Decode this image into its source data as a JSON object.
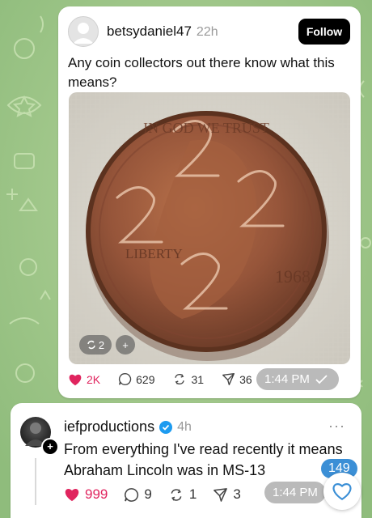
{
  "post1": {
    "username": "betsydaniel47",
    "time": "22h",
    "follow_label": "Follow",
    "text": "Any coin collectors out there know what this means?",
    "image": {
      "coin_top_text": "IN GOD WE TRUST",
      "coin_left_text": "LIBERTY",
      "coin_year": "1968",
      "badge_count": "2",
      "badge_add": "+"
    },
    "likes": "2K",
    "replies": "629",
    "reposts": "31",
    "shares": "36",
    "message_time": "1:44 PM",
    "message_status": "read-checkmark-icon"
  },
  "post2": {
    "username": "iefproductions",
    "time": "4h",
    "more": "···",
    "text": "From everything I've read recently it means Abraham Lincoln was in MS-13",
    "likes": "999",
    "replies": "9",
    "reposts": "1",
    "shares": "3",
    "message_time": "1:44 PM"
  },
  "unread_count": "149",
  "colors": {
    "chat_background": "#9cc486",
    "like": "#e0245e",
    "verified": "#1d9bf0",
    "unread_badge": "#3b8fd6"
  }
}
